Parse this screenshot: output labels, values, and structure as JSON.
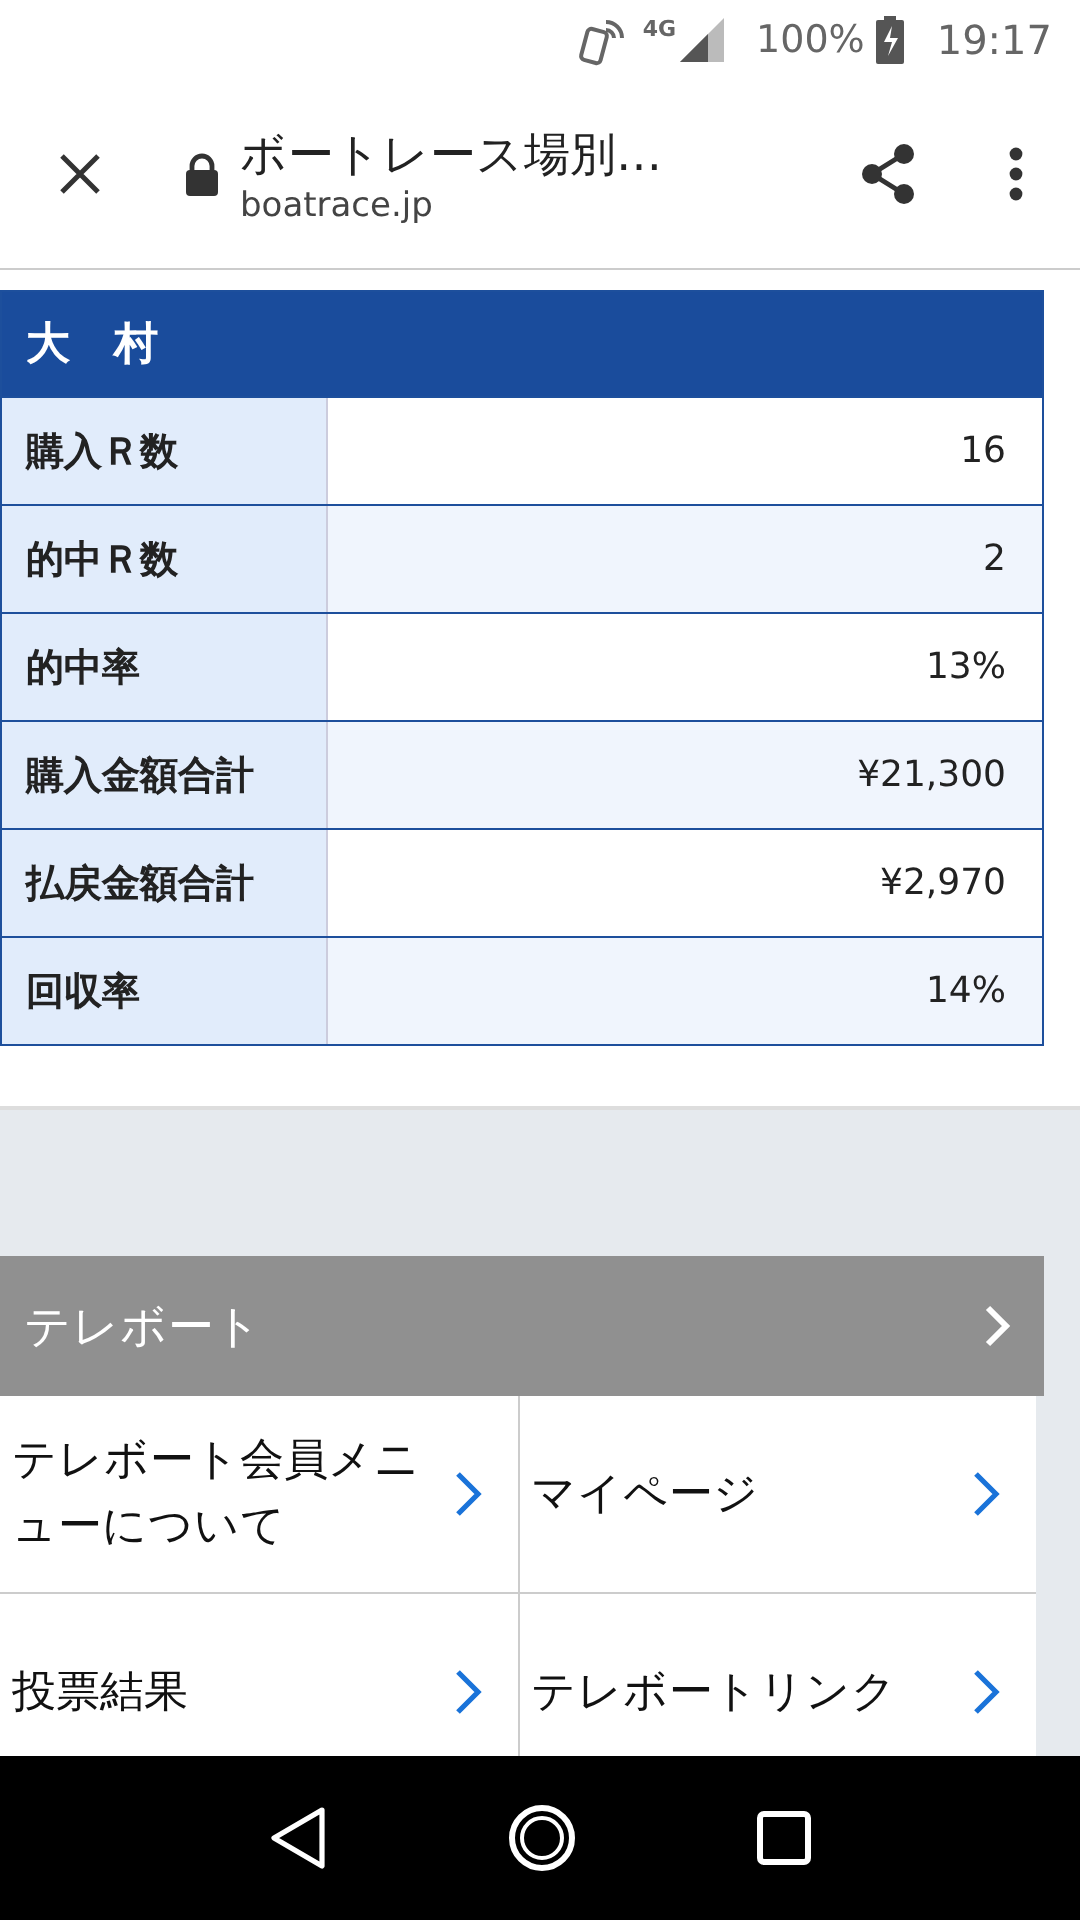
{
  "status_bar": {
    "network": "4G",
    "battery": "100%",
    "time": "19:17"
  },
  "browser": {
    "title": "ボートレース場別…",
    "url": "boatrace.jp"
  },
  "table": {
    "title": "大　村",
    "rows": [
      {
        "label": "購入Ｒ数",
        "value": "16"
      },
      {
        "label": "的中Ｒ数",
        "value": "2"
      },
      {
        "label": "的中率",
        "value": "13%"
      },
      {
        "label": "購入金額合計",
        "value": "¥21,300"
      },
      {
        "label": "払戻金額合計",
        "value": "¥2,970"
      },
      {
        "label": "回収率",
        "value": "14%"
      }
    ]
  },
  "menu": {
    "title": "テレボート",
    "items": [
      {
        "label": "テレボート会員メニューについて"
      },
      {
        "label": "マイページ"
      },
      {
        "label": "投票結果"
      },
      {
        "label": "テレボートリンク"
      }
    ]
  }
}
